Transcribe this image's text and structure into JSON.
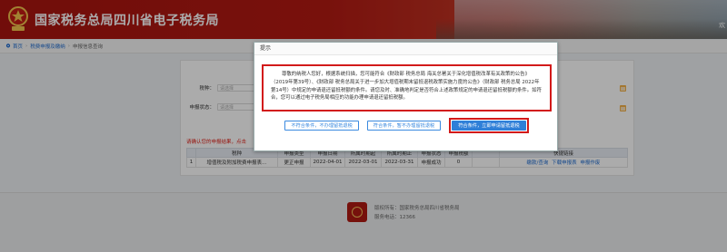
{
  "header": {
    "title": "国家税务总局四川省电子税务局",
    "right_text": "欢"
  },
  "breadcrumb": {
    "home": "首页",
    "level1": "税费申报及缴纳",
    "level2": "申报信息查询"
  },
  "form": {
    "tax_type_label": "税种：",
    "tax_type_placeholder": "请选择",
    "status_label": "申报状态：",
    "status_placeholder": "请选择"
  },
  "note": "请确认您的申报结果，点击",
  "table": {
    "headers": [
      "",
      "税种",
      "申报类型",
      "申报日期",
      "所属时期起",
      "所属时期止",
      "申报状态",
      "申报税额",
      "",
      "快捷链接"
    ],
    "rows": [
      {
        "index": "1",
        "tax": "增值税及附加税费申报表…",
        "type": "更正申报",
        "date": "2022-04-01",
        "start": "2022-03-01",
        "end": "2022-03-31",
        "status": "申报成功",
        "amount": "0",
        "blank": "",
        "links": [
          "缴款/查询",
          "下载申报表",
          "申报作废"
        ]
      }
    ]
  },
  "footer": {
    "owner": "版权所有：国家税务总局四川省税务局",
    "phone": "服务电话：12366"
  },
  "modal": {
    "title": "提示",
    "body": "尊敬的纳税人您好，根据系统扫描，您可能符合《财政部 税务总局 海关总署关于深化增值税改革有关政策的公告》（2019年第39号）、《财政部 税务总局关于进一步加大增值税期末留抵退税政策实施力度的公告》（财政部 税务总局 2022年第14号）中规定的申请退还留抵税额的条件。请您及时、准确地判定是否符合上述政策规定的申请退还留抵税额的条件。如符合，您可以通过电子税务局相应的功能办理申请退还留抵税额。",
    "btn1": "不符合条件，不办理留抵退税",
    "btn2": "符合条件，暂不办理留抵退税",
    "btn3": "符合条件，立即申请留抵退税"
  },
  "colors": {
    "header_red": "#b41a13",
    "link_blue": "#1e6bd0",
    "primary_button": "#2f7fd8",
    "highlight_border": "#d21a1a"
  }
}
